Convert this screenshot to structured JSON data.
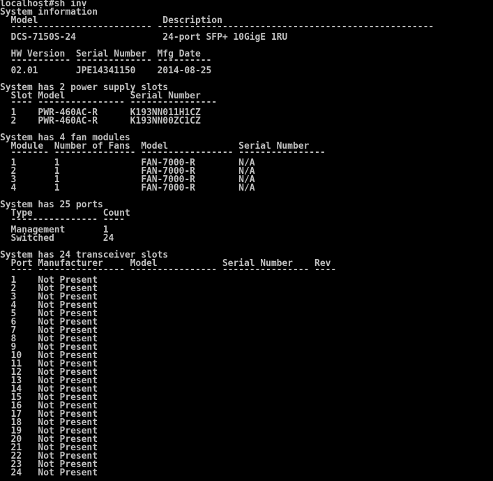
{
  "theme": {
    "background": "#000000",
    "foreground": "#c0c0c0"
  },
  "prompt": "localhost#sh inv",
  "system_info": {
    "heading": "System information",
    "header_row_1": "  Model                       Description",
    "rule_row_1": "  -------------------------- ---------------------------------------------------",
    "model_row": "  DCS-7150S-24                24-port SFP+ 10GigE 1RU",
    "header_row_2": "  HW Version  Serial Number  Mfg Date",
    "rule_row_2": "  ----------- -------------- ----------",
    "version_row": "  02.01       JPE14341150    2014-08-25"
  },
  "power_supplies": {
    "heading": "System has 2 power supply slots",
    "header": "  Slot Model            Serial Number",
    "rule": "  ---- ---------------- ----------------",
    "rows": [
      "  1    PWR-460AC-R      K193NN011H1CZ",
      "  2    PWR-460AC-R      K193NN00ZC1CZ"
    ]
  },
  "fans": {
    "heading": "System has 4 fan modules",
    "header": "  Module  Number of Fans  Model             Serial Number",
    "rule": "  ------- --------------- ----------------- ----------------",
    "rows": [
      "  1       1               FAN-7000-R        N/A",
      "  2       1               FAN-7000-R        N/A",
      "  3       1               FAN-7000-R        N/A",
      "  4       1               FAN-7000-R        N/A"
    ]
  },
  "ports": {
    "heading": "System has 25 ports",
    "header": "  Type             Count",
    "rule": "  ---------------- ----",
    "rows": [
      "  Management       1",
      "  Switched         24"
    ]
  },
  "transceivers": {
    "heading": "System has 24 transceiver slots",
    "header": "  Port Manufacturer     Model            Serial Number    Rev",
    "rule": "  ---- ---------------- ---------------- ---------------- ----",
    "rows": [
      "  1    Not Present",
      "  2    Not Present",
      "  3    Not Present",
      "  4    Not Present",
      "  5    Not Present",
      "  6    Not Present",
      "  7    Not Present",
      "  8    Not Present",
      "  9    Not Present",
      "  10   Not Present",
      "  11   Not Present",
      "  12   Not Present",
      "  13   Not Present",
      "  14   Not Present",
      "  15   Not Present",
      "  16   Not Present",
      "  17   Not Present",
      "  18   Not Present",
      "  19   Not Present",
      "  20   Not Present",
      "  21   Not Present",
      "  22   Not Present",
      "  23   Not Present",
      "  24   Not Present"
    ]
  }
}
